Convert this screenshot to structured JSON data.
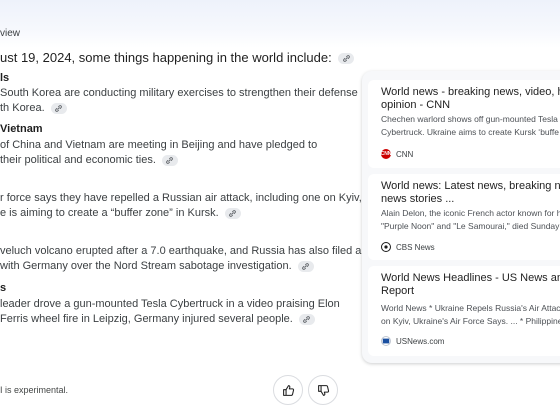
{
  "overview": {
    "label": "view",
    "intro": "ust 19, 2024, some things happening in the world include:"
  },
  "sections": [
    {
      "heading": "ls",
      "lines": [
        "South Korea are conducting military exercises to strengthen their defense",
        "th Korea."
      ]
    },
    {
      "heading": "Vietnam",
      "lines": [
        "of China and Vietnam are meeting in Beijing and have pledged to",
        "their political and economic ties."
      ]
    },
    {
      "heading": "",
      "lines": [
        "r force says they have repelled a Russian air attack, including one on Kyiv,",
        "e is aiming to create a “buffer zone” in Kursk."
      ]
    },
    {
      "heading": "",
      "lines": [
        "veluch volcano erupted after a 7.0 earthquake, and Russia has also filed a",
        "with Germany over the Nord Stream sabotage investigation."
      ]
    },
    {
      "heading": "s",
      "lines": [
        "leader drove a gun-mounted Tesla Cybertruck in a video praising Elon",
        "Ferris wheel fire in Leipzig, Germany injured several people."
      ]
    }
  ],
  "footer": {
    "note": "I is experimental."
  },
  "sources": [
    {
      "title_lines": [
        "World news - breaking news, video, head",
        "opinion - CNN"
      ],
      "snippet_lines": [
        "Chechen warlord shows off gun-mounted Tesla",
        "Cybertruck. Ukraine aims to create Kursk ‘buffe"
      ],
      "source": "CNN"
    },
    {
      "title_lines": [
        "World news: Latest news, breaking news,",
        "news stories ..."
      ],
      "snippet_lines": [
        "Alain Delon, the iconic French actor known for h",
        "\"Purple Noon\" and \"Le Samourai,\" died Sunday a"
      ],
      "source": "CBS News"
    },
    {
      "title_lines": [
        "World News Headlines - US News and Wo",
        "Report"
      ],
      "snippet_lines": [
        "World News * Ukraine Repels Russia's Air Attac",
        "on Kyiv, Ukraine's Air Force Says. ... * Philippine"
      ],
      "source": "USNews.com"
    }
  ],
  "icons": {
    "link": "link-icon",
    "thumbs_up": "thumbs-up-icon",
    "thumbs_down": "thumbs-down-icon"
  },
  "colors": {
    "cnn_logo": "#cc0000",
    "link_chip": "#e8eaed",
    "panel_bg": "#f7f8fa"
  }
}
